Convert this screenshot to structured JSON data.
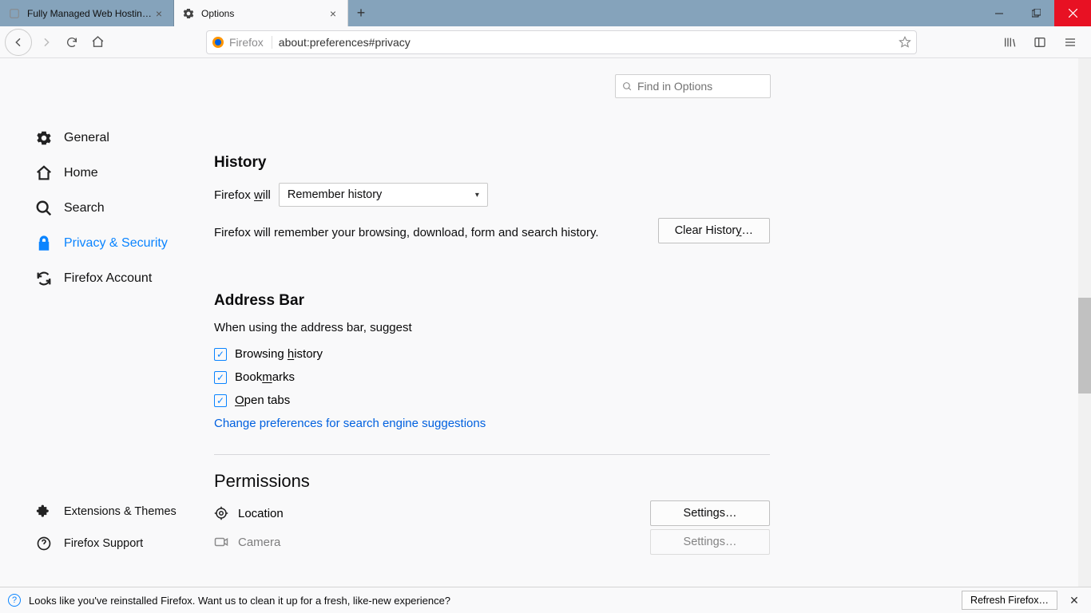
{
  "tabs": [
    {
      "title": "Fully Managed Web Hosting USA | "
    },
    {
      "title": "Options"
    }
  ],
  "urlbar": {
    "identity": "Firefox",
    "url": "about:preferences#privacy"
  },
  "search": {
    "placeholder": "Find in Options"
  },
  "sidebar": {
    "items": [
      {
        "label": "General"
      },
      {
        "label": "Home"
      },
      {
        "label": "Search"
      },
      {
        "label": "Privacy & Security"
      },
      {
        "label": "Firefox Account"
      }
    ],
    "bottom": [
      {
        "label": "Extensions & Themes"
      },
      {
        "label": "Firefox Support"
      }
    ]
  },
  "history": {
    "heading": "History",
    "will_label_pre": "Firefox ",
    "will_label_u": "w",
    "will_label_post": "ill",
    "select_value": "Remember history",
    "desc": "Firefox will remember your browsing, download, form and search history.",
    "clear_btn_pre": "Clear Histor",
    "clear_btn_u": "y",
    "clear_btn_post": "…"
  },
  "addressbar": {
    "heading": "Address Bar",
    "desc": "When using the address bar, suggest",
    "cb1_pre": "Browsing ",
    "cb1_u": "h",
    "cb1_post": "istory",
    "cb2_pre": "Book",
    "cb2_u": "m",
    "cb2_post": "arks",
    "cb3_u": "O",
    "cb3_post": "pen tabs",
    "link": "Change preferences for search engine suggestions"
  },
  "permissions": {
    "heading": "Permissions",
    "rows": [
      {
        "label": "Location",
        "btn": "Settings…"
      },
      {
        "label": "Camera",
        "btn": "Settings…"
      }
    ]
  },
  "helpbar": {
    "text": "Looks like you've reinstalled Firefox. Want us to clean it up for a fresh, like-new experience?",
    "refresh": "Refresh Firefox…"
  }
}
